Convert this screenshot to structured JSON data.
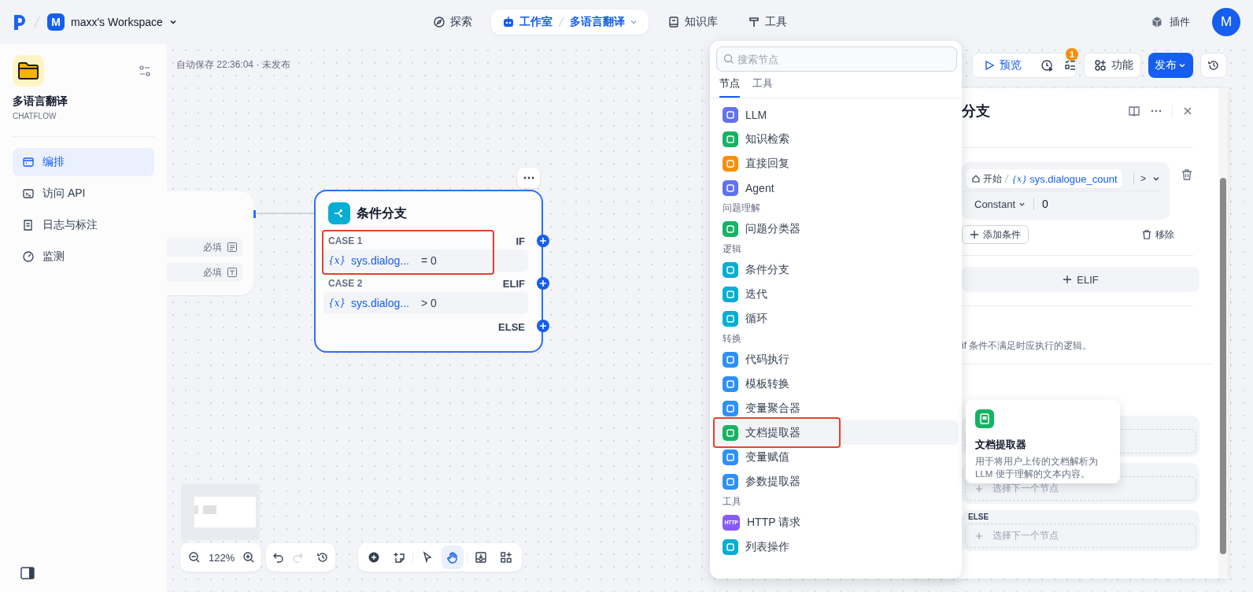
{
  "topbar": {
    "workspace_initial": "M",
    "workspace": "maxx's Workspace",
    "nav": [
      {
        "label": "探索",
        "selected": false
      },
      {
        "label": "工作室",
        "selected": true,
        "app": "多语言翻译"
      },
      {
        "label": "知识库",
        "selected": false
      },
      {
        "label": "工具",
        "selected": false
      }
    ],
    "plugins": "插件",
    "avatar": "M"
  },
  "sidebar": {
    "app_name": "多语言翻译",
    "app_type": "CHATFLOW",
    "items": [
      {
        "label": "编排",
        "selected": true
      },
      {
        "label": "访问 API",
        "selected": false
      },
      {
        "label": "日志与标注",
        "selected": false
      },
      {
        "label": "监测",
        "selected": false
      }
    ]
  },
  "canvas": {
    "autosave": "自动保存 22:36:04 · 未发布",
    "start_node": {
      "fields": [
        {
          "tag": "必填"
        },
        {
          "tag": "必填"
        }
      ]
    },
    "if_node": {
      "title": "条件分支",
      "cases": [
        {
          "label": "CASE 1",
          "branch": "IF",
          "variable_icon": "{x}",
          "variable": "sys.dialog...",
          "condition": "= 0",
          "highlighted": true
        },
        {
          "label": "CASE 2",
          "branch": "ELIF",
          "variable_icon": "{x}",
          "variable": "sys.dialog...",
          "condition": "> 0",
          "highlighted": false
        }
      ],
      "else": "ELSE"
    },
    "zoom": "122%",
    "history": [
      {
        "kind": "undo",
        "disabled": false
      },
      {
        "kind": "redo",
        "disabled": true
      },
      {
        "kind": "history",
        "disabled": false
      }
    ],
    "tools": [
      {
        "kind": "add",
        "selected": false
      },
      {
        "kind": "note",
        "selected": false
      },
      {
        "kind": "pointer",
        "selected": false
      },
      {
        "kind": "hand",
        "selected": true
      },
      {
        "kind": "export",
        "selected": false
      },
      {
        "kind": "layout",
        "selected": false
      }
    ]
  },
  "actions": {
    "preview": "预览",
    "checklist_badge": "1",
    "features": "功能",
    "publish": "发布"
  },
  "panel": {
    "title": "分支",
    "condition": {
      "source": "开始",
      "variable_icon": "{x}",
      "variable": "sys.dialogue_count",
      "operator": ">",
      "value_type": "Constant",
      "value": "0"
    },
    "add_condition": "添加条件",
    "remove": "移除",
    "add_elif": "ELIF",
    "else_description": "if 条件不满足时应执行的逻辑。",
    "branches": [
      {
        "placeholder": "选择下一个节点"
      },
      {
        "label": "ELSE",
        "placeholder": "选择下一个节点"
      }
    ]
  },
  "menu": {
    "search_placeholder": "搜索节点",
    "tabs": [
      {
        "label": "节点",
        "selected": true
      },
      {
        "label": "工具",
        "selected": false
      }
    ],
    "sections": [
      {
        "items": [
          {
            "label": "LLM",
            "color": "#6172f3",
            "selected": false,
            "annotated": false
          },
          {
            "label": "知识检索",
            "color": "#16b364",
            "selected": false,
            "annotated": false
          },
          {
            "label": "直接回复",
            "color": "#f79009",
            "selected": false,
            "annotated": false
          },
          {
            "label": "Agent",
            "color": "#6172f3",
            "selected": false,
            "annotated": false
          }
        ]
      },
      {
        "heading": "问题理解",
        "items": [
          {
            "label": "问题分类器",
            "color": "#16b364",
            "selected": false,
            "annotated": false
          }
        ]
      },
      {
        "heading": "逻辑",
        "items": [
          {
            "label": "条件分支",
            "color": "#06aed4",
            "selected": false,
            "annotated": false
          },
          {
            "label": "迭代",
            "color": "#06aed4",
            "selected": false,
            "annotated": false
          },
          {
            "label": "循环",
            "color": "#06aed4",
            "selected": false,
            "annotated": false
          }
        ]
      },
      {
        "heading": "转换",
        "items": [
          {
            "label": "代码执行",
            "color": "#2e90fa",
            "selected": false,
            "annotated": false
          },
          {
            "label": "模板转换",
            "color": "#2e90fa",
            "selected": false,
            "annotated": false
          },
          {
            "label": "变量聚合器",
            "color": "#2e90fa",
            "selected": false,
            "annotated": false
          },
          {
            "label": "文档提取器",
            "color": "#16b364",
            "selected": true,
            "annotated": true
          },
          {
            "label": "变量赋值",
            "color": "#2e90fa",
            "selected": false,
            "annotated": false
          },
          {
            "label": "参数提取器",
            "color": "#2e90fa",
            "selected": false,
            "annotated": false
          }
        ]
      },
      {
        "heading": "工具",
        "items": [
          {
            "label": "HTTP 请求",
            "color": "#875bf7",
            "icon_text": "HTTP",
            "selected": false,
            "annotated": false
          },
          {
            "label": "列表操作",
            "color": "#06aed4",
            "selected": false,
            "annotated": false
          }
        ]
      }
    ]
  },
  "tooltip": {
    "title": "文档提取器",
    "description": "用于将用户上传的文档解析为 LLM 便于理解的文本内容。"
  }
}
